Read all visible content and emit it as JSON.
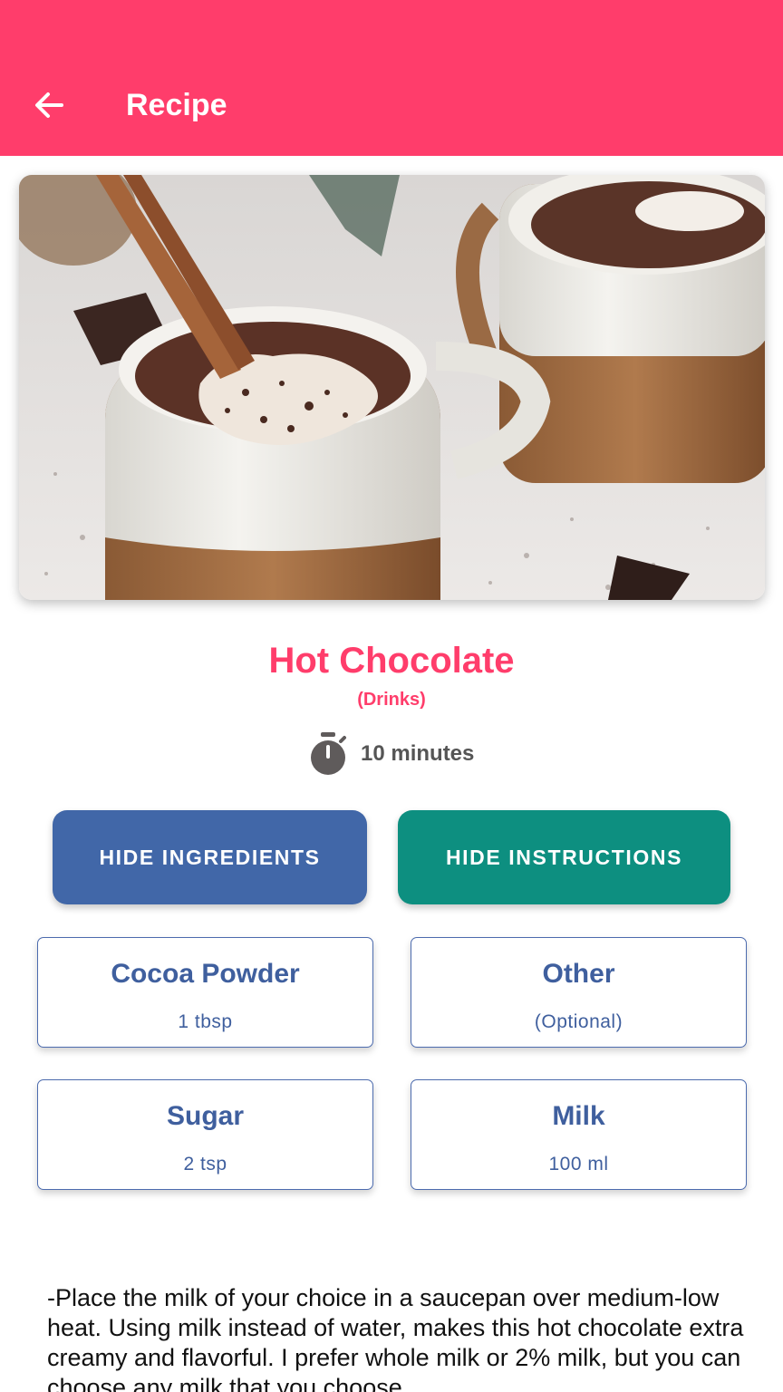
{
  "appbar": {
    "title": "Recipe",
    "back_icon": "arrow-left-icon",
    "color": "#FF3D6B"
  },
  "recipe": {
    "image_icon": "hot-chocolate-photo",
    "title": "Hot Chocolate",
    "category": "(Drinks)",
    "time": "10 minutes",
    "timer_icon": "stopwatch-icon"
  },
  "buttons": {
    "ingredients_label": "HIDE INGREDIENTS",
    "ingredients_color": "#4167A8",
    "instructions_label": "HIDE INSTRUCTIONS",
    "instructions_color": "#0D8F80"
  },
  "ingredients": [
    {
      "name": "Cocoa Powder",
      "qty": "1 tbsp"
    },
    {
      "name": "Other",
      "qty": "(Optional)"
    },
    {
      "name": "Sugar",
      "qty": "2 tsp"
    },
    {
      "name": "Milk",
      "qty": "100 ml"
    }
  ],
  "instructions": {
    "text": "-Place the milk of your choice in a saucepan over medium-low heat. Using milk instead of water, makes this hot chocolate extra creamy and flavorful. I prefer whole milk or 2% milk, but you can choose any milk that you choose"
  }
}
